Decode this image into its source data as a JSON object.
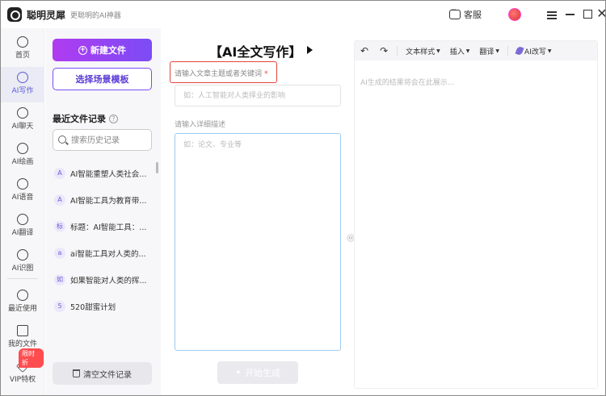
{
  "titlebar": {
    "app_name": "聪明灵犀",
    "tagline": "更聪明的AI神器",
    "support_label": "客服"
  },
  "nav": {
    "items": [
      {
        "label": "首页",
        "icon": "home-icon"
      },
      {
        "label": "AI写作",
        "icon": "ai-write-icon"
      },
      {
        "label": "AI聊天",
        "icon": "chat-icon"
      },
      {
        "label": "AI绘画",
        "icon": "paint-icon"
      },
      {
        "label": "AI语音",
        "icon": "headphone-icon"
      },
      {
        "label": "AI翻译",
        "icon": "translate-icon"
      },
      {
        "label": "AI识图",
        "icon": "image-recognize-icon"
      },
      {
        "label": "最近使用",
        "icon": "clock-icon"
      },
      {
        "label": "我的文件",
        "icon": "file-icon"
      },
      {
        "label": "VIP特权",
        "icon": "diamond-icon"
      }
    ],
    "discount_badge": "限时折"
  },
  "side": {
    "new_file_label": "新建文件",
    "template_label": "选择场景模板",
    "recent_title": "最近文件记录",
    "search_placeholder": "搜索历史记录",
    "history": [
      {
        "badge": "A",
        "text": "AI智能重塑人类社会..."
      },
      {
        "badge": "A",
        "text": "AI智能工具为教育带..."
      },
      {
        "badge": "标",
        "text": "标题：AI智能工具：..."
      },
      {
        "badge": "a",
        "text": "ai智能工具对人类的..."
      },
      {
        "badge": "如",
        "text": "如果智能对人类的挥..."
      },
      {
        "badge": "5",
        "text": "520甜蜜计划"
      }
    ],
    "clear_label": "清空文件记录"
  },
  "mid": {
    "title": "【AI全文写作】",
    "topic_label": "请输入文章主题或者关键词",
    "required_mark": "*",
    "topic_placeholder": "如：人工智能对人类择业的影响",
    "detail_label": "请输入详细描述",
    "detail_placeholder": "如：论文、专业等",
    "generate_label": "开始生成"
  },
  "right": {
    "toolbar": {
      "undo": "↶",
      "redo": "↷",
      "text_style": "文本样式",
      "insert": "插入",
      "translate": "翻译",
      "ai_rewrite": "AI改写"
    },
    "output_placeholder": "AI生成的结果将会在此展示..."
  }
}
